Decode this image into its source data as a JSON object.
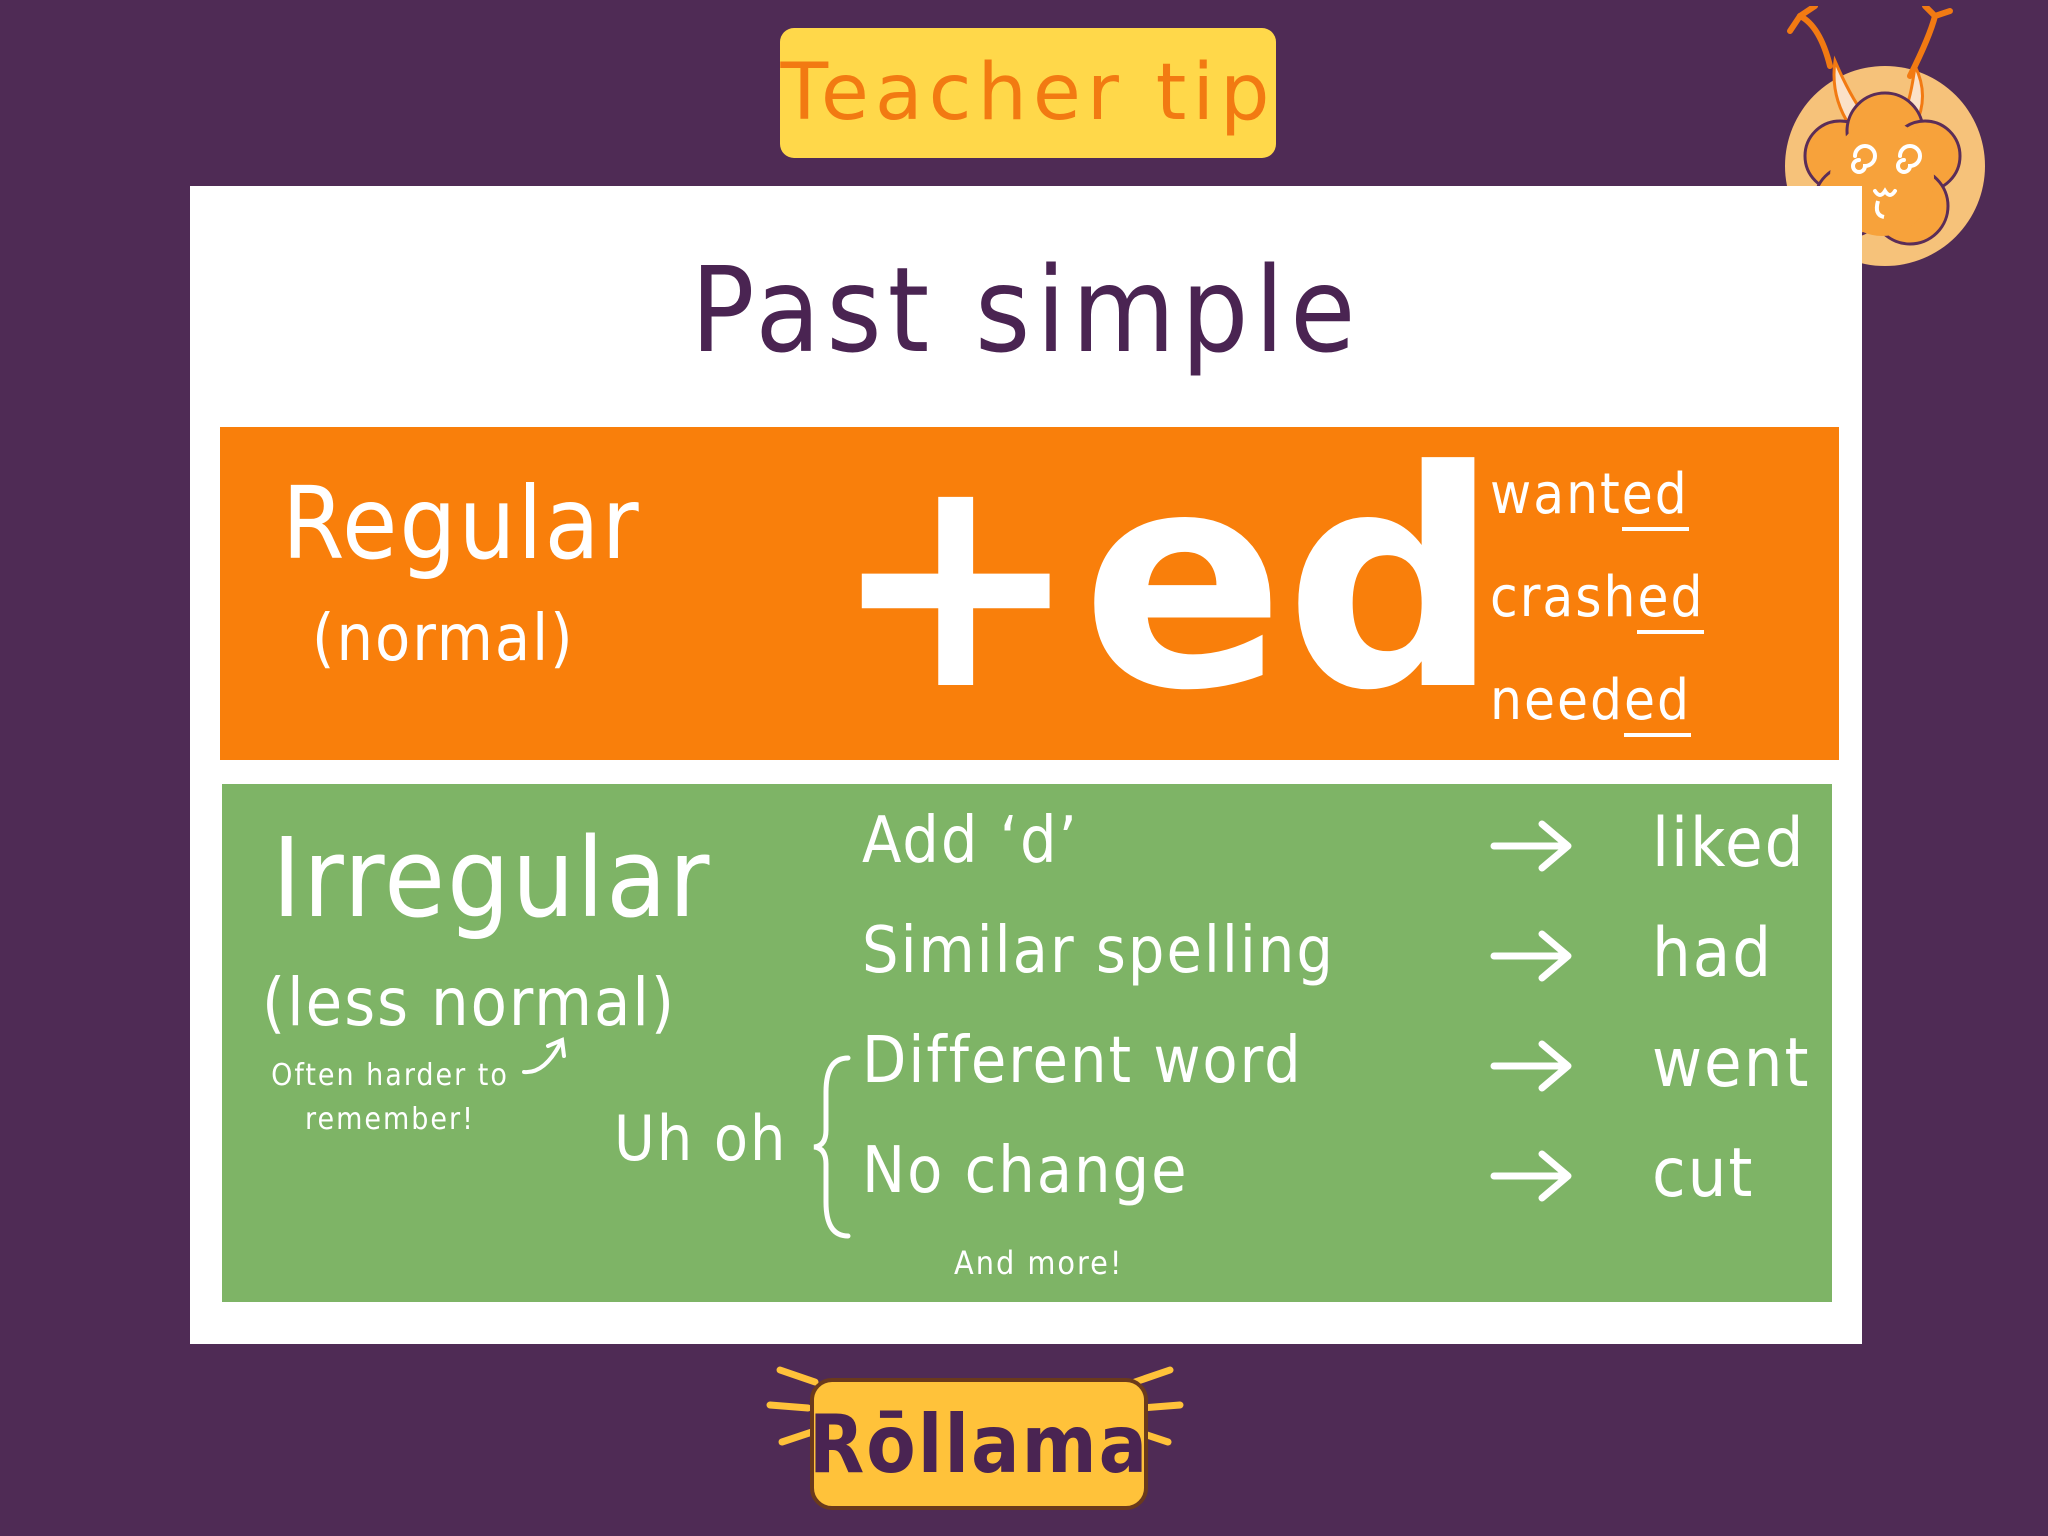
{
  "badge": {
    "text": "Teacher tip"
  },
  "title": "Past simple",
  "regular": {
    "label": "Regular",
    "sub": "(normal)",
    "rule": "+ed",
    "examples": [
      {
        "stem": "want",
        "ending": "ed"
      },
      {
        "stem": "crash",
        "ending": "ed"
      },
      {
        "stem": "need",
        "ending": "ed"
      }
    ]
  },
  "irregular": {
    "label": "Irregular",
    "sub": "(less normal)",
    "note": "Often harder to remember!",
    "uhoh": "Uh oh",
    "rows": [
      {
        "rule": "Add ‘d’",
        "word": "liked"
      },
      {
        "rule": "Similar spelling",
        "word": "had"
      },
      {
        "rule": "Different word",
        "word": "went"
      },
      {
        "rule": "No change",
        "word": "cut"
      }
    ],
    "more": "And more!"
  },
  "brand": {
    "name": "Rōllama"
  },
  "colors": {
    "background": "#4f2b55",
    "badge": "#ffd84a",
    "badge_text": "#f27a12",
    "regular": "#f97f0b",
    "irregular": "#7eb466",
    "title": "#4a2452"
  }
}
